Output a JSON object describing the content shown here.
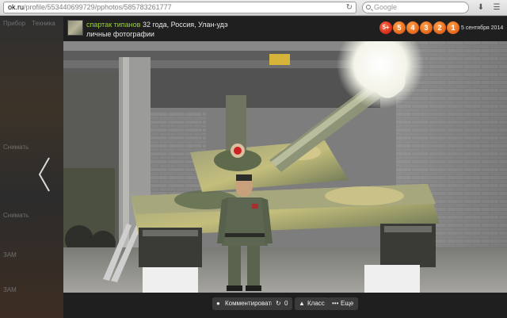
{
  "browser": {
    "url_host": "ok.ru",
    "url_path": "/profile/553440699729/pphotos/585783261777",
    "search_placeholder": "Google"
  },
  "photo_layer": {
    "author_name": "спартак типанов",
    "author_info": " 32 года, Россия, Улан-удэ",
    "album_name": "личные фотографии",
    "date": "5 сентября 2014",
    "ratings": [
      "5+",
      "5",
      "4",
      "3",
      "2",
      "1"
    ],
    "actions": {
      "comment": "Комментировать",
      "reshare_count": "0",
      "like": "Класс",
      "more": "Еще"
    }
  },
  "background_page": {
    "left_labels": [
      "Прибор",
      "Техника",
      "Снимать",
      "Снимать",
      "ЗАМ",
      "ЗАМ"
    ]
  },
  "colors": {
    "accent_orange": "#e2641a",
    "username_green": "#9ccf3c",
    "layer_bg": "#1f1f1f"
  }
}
